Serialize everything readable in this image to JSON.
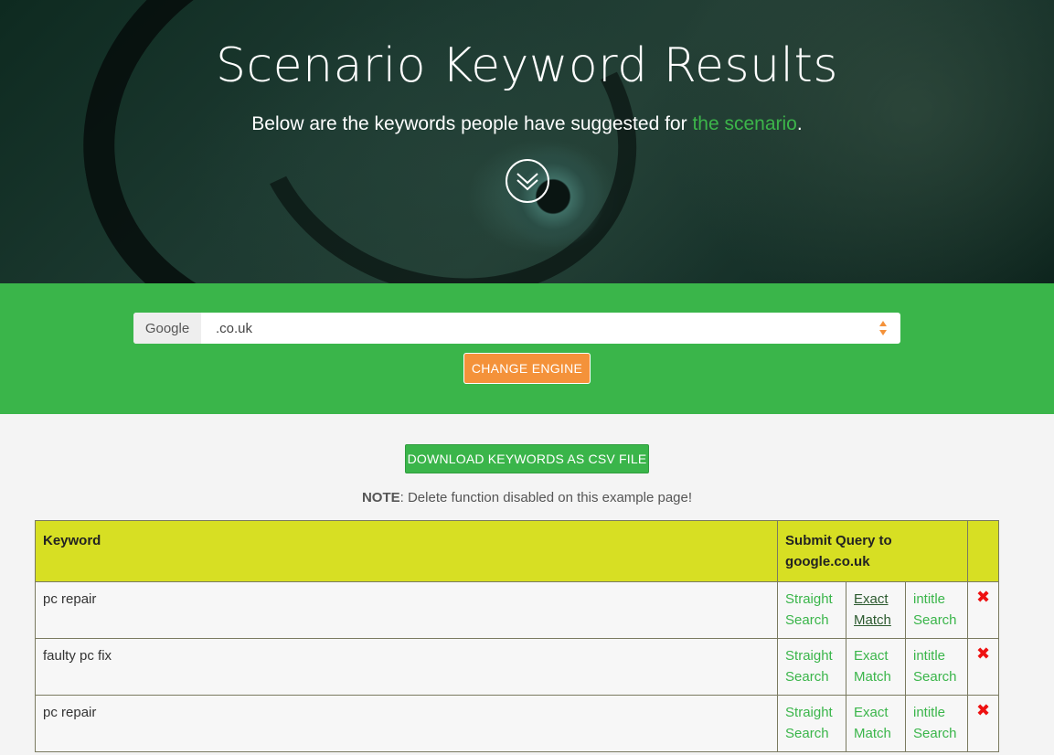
{
  "hero": {
    "title": "Scenario Keyword Results",
    "subtitle_prefix": "Below are the keywords people have suggested for ",
    "subtitle_link": "the scenario",
    "subtitle_suffix": ".",
    "down_icon": "double-chevron-down-icon"
  },
  "engine": {
    "label": "Google",
    "selected": ".co.uk",
    "change_button": "CHANGE ENGINE",
    "accent_color": "#f4923a"
  },
  "actions": {
    "download_button": "DOWNLOAD KEYWORDS AS CSV FILE",
    "note_label": "NOTE",
    "note_text": ": Delete function disabled on this example page!"
  },
  "table": {
    "headers": {
      "keyword": "Keyword",
      "submit": "Submit Query to google.co.uk"
    },
    "rows": [
      {
        "keyword": "pc repair",
        "straight": "Straight Search",
        "exact": "Exact Match",
        "intitle": "intitle Search"
      },
      {
        "keyword": "faulty pc fix",
        "straight": "Straight Search",
        "exact": "Exact Match",
        "intitle": "intitle Search"
      },
      {
        "keyword": "pc repair",
        "straight": "Straight Search",
        "exact": "Exact Match",
        "intitle": "intitle Search"
      }
    ],
    "delete_icon": "x-icon"
  },
  "colors": {
    "brand_green": "#3ab54a",
    "header_yellow": "#d7df23",
    "delete_red": "#ee1111"
  }
}
